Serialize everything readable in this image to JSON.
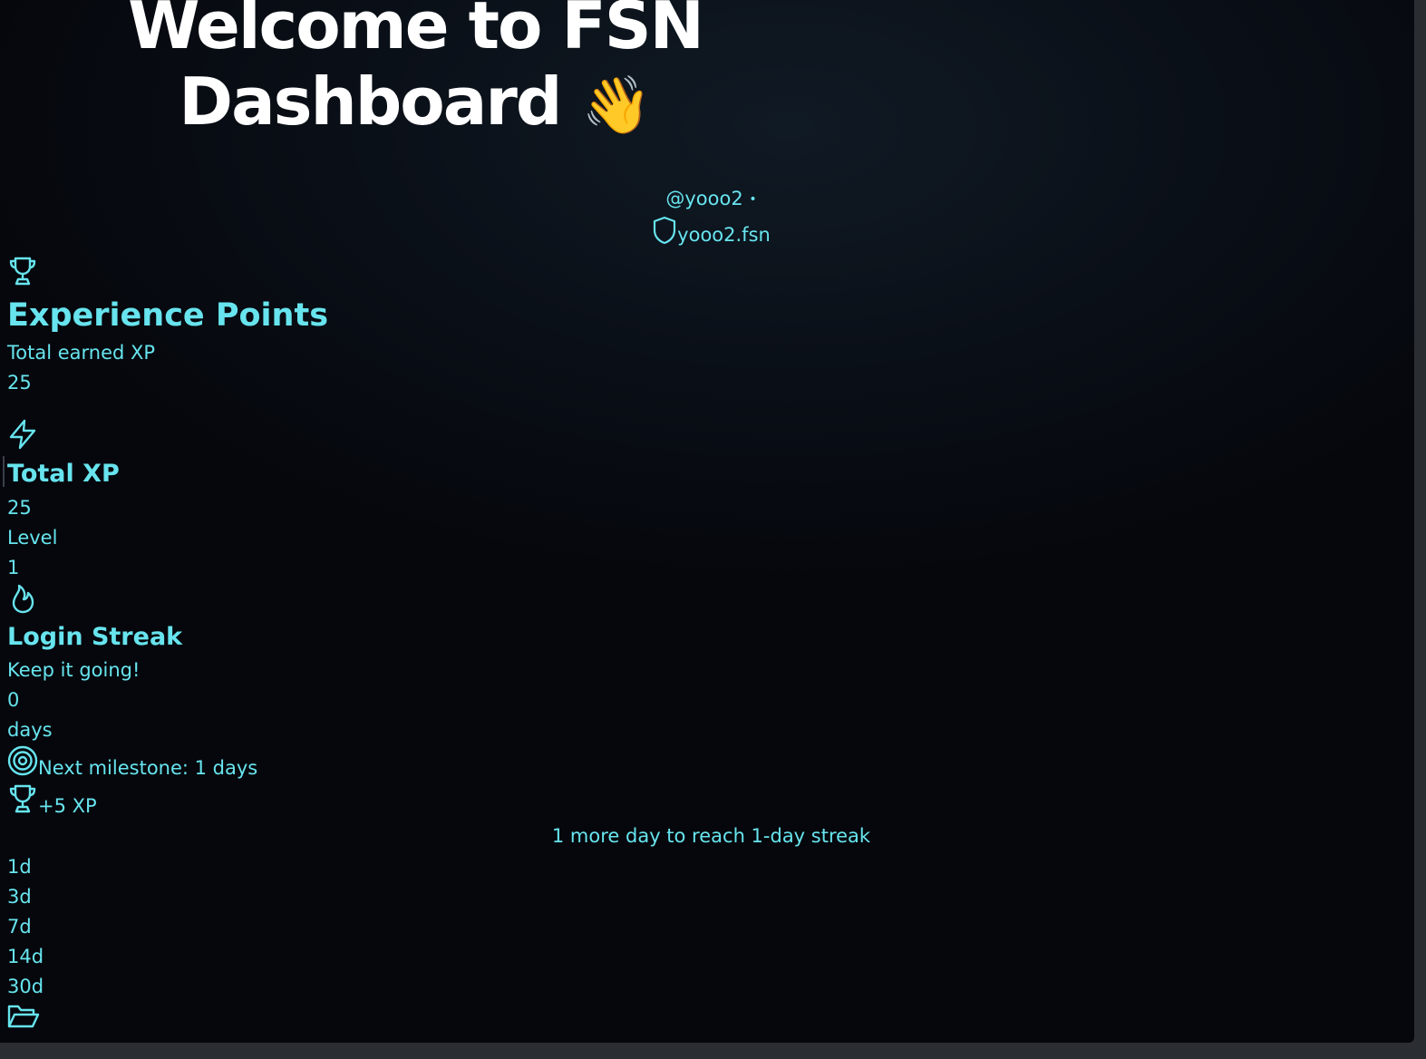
{
  "header": {
    "title_line1": "Welcome to FSN",
    "title_line2": "Dashboard",
    "wave_emoji": "👋"
  },
  "user": {
    "handle": "@yooo2",
    "separator": "•",
    "domain": "yooo2.fsn"
  },
  "experience": {
    "icon": "trophy-icon",
    "title": "Experience Points",
    "subtitle": "Total earned XP",
    "value": "25"
  },
  "total_xp": {
    "icon": "lightning-icon",
    "title": "Total XP",
    "value": "25",
    "level_label": "Level",
    "level_value": "1"
  },
  "streak": {
    "icon": "flame-icon",
    "title": "Login Streak",
    "subtitle": "Keep it going!",
    "value": "0",
    "unit": "days",
    "milestone_icon": "target-icon",
    "milestone_text": "Next milestone: 1 days",
    "reward_icon": "trophy-icon",
    "reward_text": "+5 XP",
    "progress_message": "1 more day to reach 1-day streak",
    "milestones": [
      "1d",
      "3d",
      "7d",
      "14d",
      "30d"
    ]
  },
  "footer": {
    "icon": "folder-open-icon"
  },
  "colors": {
    "accent": "#67e4ee",
    "title": "#ffffff",
    "background": "#05070c"
  }
}
